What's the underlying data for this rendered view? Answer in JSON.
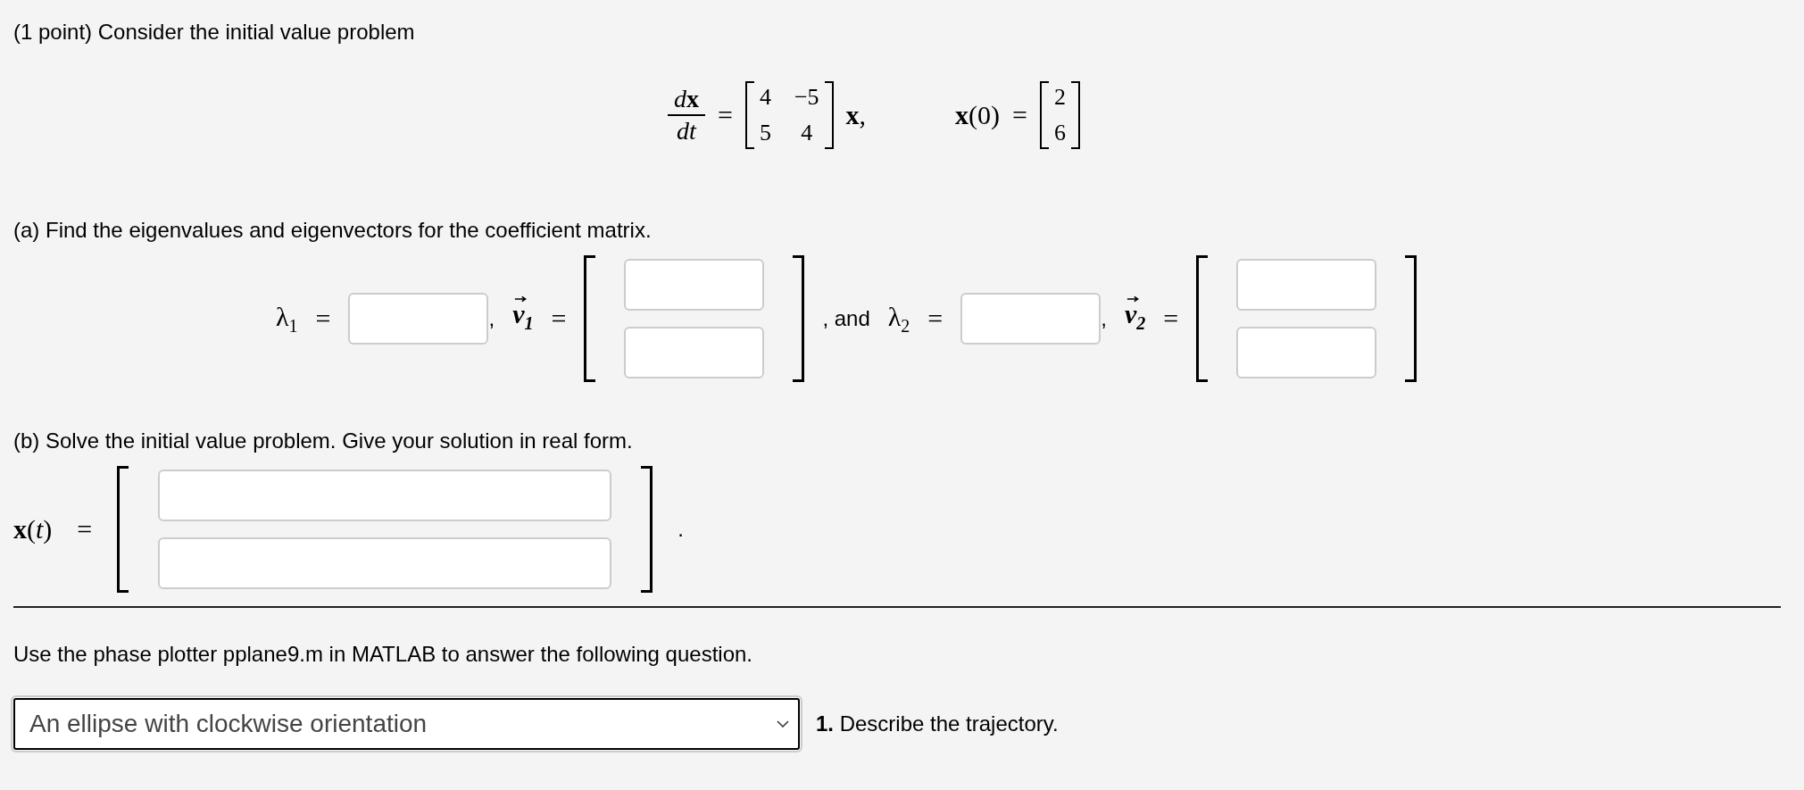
{
  "title": "(1 point) Consider the initial value problem",
  "equation": {
    "left": [
      {
        "kind": "fraction",
        "num": "d**x**",
        "den": "dt"
      },
      {
        "kind": "math",
        "text": "="
      },
      {
        "kind": "matrix",
        "rows": [
          [
            "4",
            "−5"
          ],
          [
            "5",
            "4"
          ]
        ]
      },
      {
        "kind": "math",
        "text": "**x**,"
      }
    ],
    "right": [
      {
        "kind": "math",
        "text": "**x**(0)"
      },
      {
        "kind": "math",
        "text": "="
      },
      {
        "kind": "matrix",
        "rows": [
          [
            "2"
          ],
          [
            "6"
          ]
        ]
      }
    ]
  },
  "part_a": {
    "label": "(a) Find the eigenvalues and eigenvectors for the coefficient matrix.",
    "parts": [
      {
        "kind": "math",
        "text": "λ$_{1}$"
      },
      {
        "kind": "math",
        "text": "="
      },
      {
        "kind": "field"
      },
      {
        "kind": "text",
        "text": ","
      },
      {
        "kind": "vec",
        "text": "v$_{1}$"
      },
      {
        "kind": "math",
        "text": "="
      },
      {
        "kind": "vector",
        "entries": [
          {
            "kind": "field"
          },
          {
            "kind": "field"
          }
        ]
      },
      {
        "kind": "text",
        "text": ", and"
      },
      {
        "kind": "math",
        "text": "λ$_{2}$"
      },
      {
        "kind": "math",
        "text": "="
      },
      {
        "kind": "field"
      },
      {
        "kind": "text",
        "text": ","
      },
      {
        "kind": "vec",
        "text": "v$_{2}$"
      },
      {
        "kind": "math",
        "text": "="
      },
      {
        "kind": "vector",
        "entries": [
          {
            "kind": "field"
          },
          {
            "kind": "field"
          }
        ]
      }
    ]
  },
  "part_b": {
    "label": "(b) Solve the initial value problem. Give your solution in real form.",
    "parts": [
      {
        "kind": "math",
        "text": "**x**(*t*)"
      },
      {
        "kind": "math",
        "text": "="
      },
      {
        "kind": "vector_wide",
        "entries": [
          {
            "kind": "field"
          },
          {
            "kind": "field"
          }
        ]
      },
      {
        "kind": "text",
        "text": "."
      }
    ]
  },
  "instruction": "Use the phase plotter pplane9.m in MATLAB to answer the following question.",
  "question": {
    "dropdown": {
      "value": "An ellipse with clockwise orientation"
    },
    "number": "1.",
    "text": "Describe the trajectory."
  }
}
